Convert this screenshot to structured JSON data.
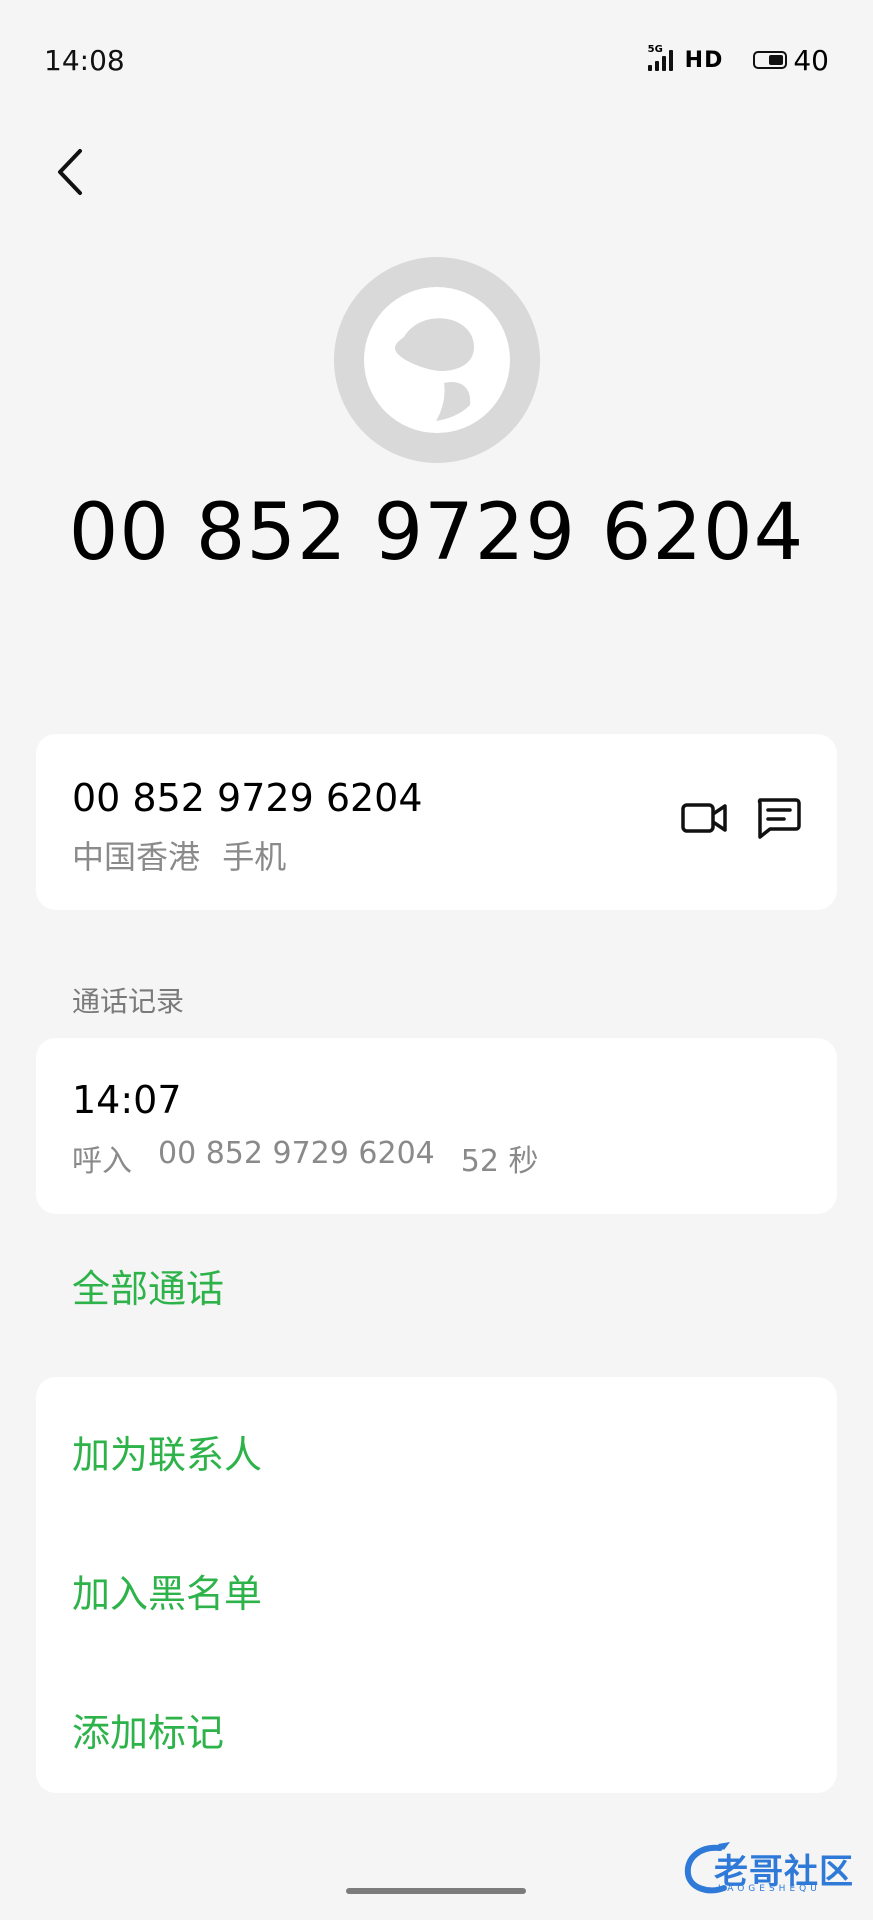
{
  "status": {
    "time": "14:08",
    "network": "5G",
    "hd": "HD",
    "battery": "40"
  },
  "contact": {
    "display_number": "00 852 9729 6204",
    "number": "00 852 9729 6204",
    "region": "中国香港",
    "type": "手机"
  },
  "call_log": {
    "section_title": "通话记录",
    "entries": [
      {
        "time": "14:07",
        "direction": "呼入",
        "number": "00 852 9729 6204",
        "duration": "52 秒"
      }
    ],
    "all_calls_label": "全部通话"
  },
  "actions": {
    "add_contact": "加为联系人",
    "block": "加入黑名单",
    "add_tag": "添加标记"
  },
  "watermark": {
    "text": "老哥社区",
    "sub": "LAOGESHEQU"
  },
  "colors": {
    "accent": "#2db34a",
    "background": "#f5f5f5",
    "card": "#ffffff",
    "secondary_text": "#8a8a8a",
    "avatar": "#d9d9d9"
  }
}
